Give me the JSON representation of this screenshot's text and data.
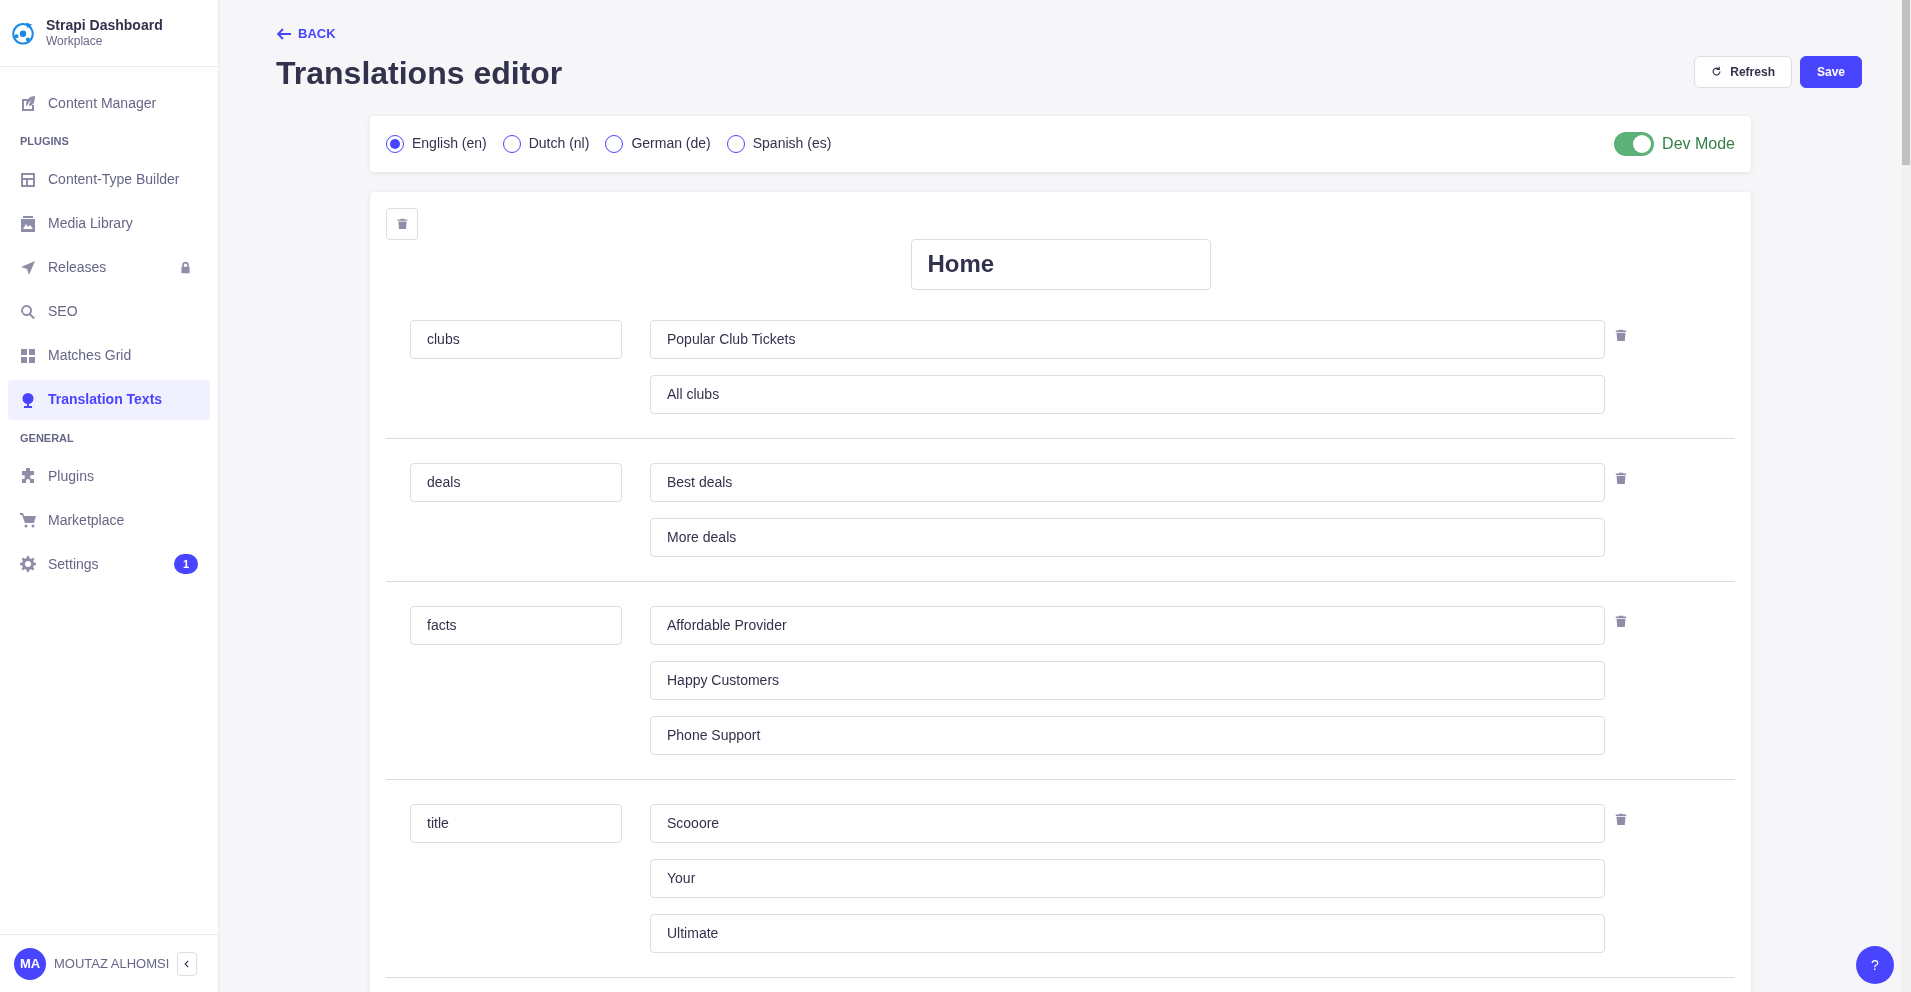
{
  "sidebar": {
    "brand": {
      "title": "Strapi Dashboard",
      "subtitle": "Workplace"
    },
    "sections": [
      {
        "items": [
          {
            "label": "Content Manager",
            "kind": "feather",
            "selected": false
          }
        ]
      },
      {
        "heading": "PLUGINS",
        "items": [
          {
            "label": "Content-Type Builder",
            "kind": "layout",
            "selected": false
          },
          {
            "label": "Media Library",
            "kind": "image",
            "selected": false
          },
          {
            "label": "Releases",
            "kind": "send",
            "selected": false,
            "locked": true
          },
          {
            "label": "SEO",
            "kind": "search",
            "selected": false
          },
          {
            "label": "Matches Grid",
            "kind": "grid",
            "selected": false
          },
          {
            "label": "Translation Texts",
            "kind": "globe",
            "selected": true
          }
        ]
      },
      {
        "heading": "GENERAL",
        "items": [
          {
            "label": "Plugins",
            "kind": "puzzle",
            "selected": false
          },
          {
            "label": "Marketplace",
            "kind": "cart",
            "selected": false
          },
          {
            "label": "Settings",
            "kind": "gear",
            "selected": false,
            "badge": "1"
          }
        ]
      }
    ],
    "user": {
      "initials": "MA",
      "name": "MOUTAZ ALHOMSI"
    }
  },
  "header": {
    "back": "BACK",
    "title": "Translations editor",
    "buttons": [
      {
        "label": "Refresh",
        "kind": "secondary"
      },
      {
        "label": "Save",
        "kind": "primary"
      }
    ]
  },
  "languages": [
    {
      "label": "English (en)",
      "selected": true
    },
    {
      "label": "Dutch (nl)",
      "selected": false
    },
    {
      "label": "German (de)",
      "selected": false
    },
    {
      "label": "Spanish (es)",
      "selected": false
    }
  ],
  "dev_mode": {
    "label": "Dev Mode",
    "on": true
  },
  "section": {
    "title": "Home",
    "entries": [
      {
        "key": "clubs",
        "values": [
          "Popular Club Tickets",
          "All clubs"
        ]
      },
      {
        "key": "deals",
        "values": [
          "Best deals",
          "More deals"
        ]
      },
      {
        "key": "facts",
        "values": [
          "Affordable Provider",
          "Happy Customers",
          "Phone Support"
        ]
      },
      {
        "key": "title",
        "values": [
          "Scooore",
          "Your",
          "Ultimate"
        ]
      }
    ]
  },
  "help_button": "?"
}
